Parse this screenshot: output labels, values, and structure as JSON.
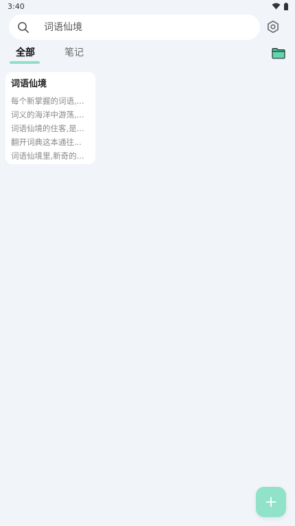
{
  "status_bar": {
    "time": "3:40",
    "icons": [
      "wifi-icon",
      "battery-icon"
    ]
  },
  "search": {
    "placeholder": "词语仙境",
    "icon": "search-icon"
  },
  "header_actions": {
    "settings_icon": "settings-icon",
    "folder_icon": "folder-icon"
  },
  "tabs": [
    {
      "label": "全部",
      "selected": true
    },
    {
      "label": "笔记",
      "selected": false
    }
  ],
  "notes": [
    {
      "title": "词语仙境",
      "lines": [
        "每个新掌握的词语,...",
        "词义的海洋中游荡,...",
        "词语仙境的住客,是...",
        "翻开词典这本通往...",
        "词语仙境里,新奇的..."
      ]
    }
  ],
  "fab": {
    "icon": "plus-icon"
  },
  "colors": {
    "background": "#f1f4f9",
    "accent": "#90e2c9",
    "folder_green": "#3dbf8f"
  }
}
